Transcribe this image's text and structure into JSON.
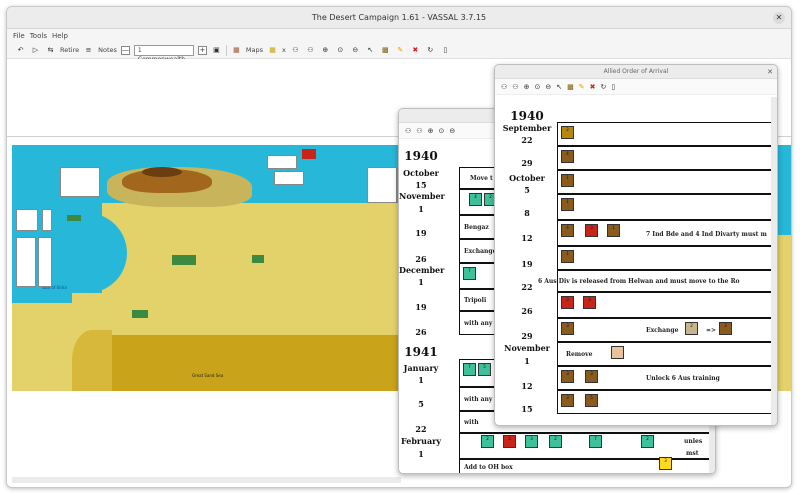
{
  "app": {
    "title": "The Desert Campaign 1.61 - VASSAL 3.7.15"
  },
  "menu": [
    "File",
    "Tools",
    "Help"
  ],
  "toolbar": {
    "retire": "Retire",
    "notes": "Notes",
    "minus": "—",
    "plus": "+",
    "faction": "1 Commonwealth",
    "maps": "Maps",
    "x": "x"
  },
  "map": {
    "label_gulf": "Gulf of Sidra",
    "label_sea": "Great Sand Sea"
  },
  "allied_window": {
    "title": "Allied Order of Arrival",
    "dates": [
      {
        "text": "1940",
        "size": 12
      },
      {
        "text": "September",
        "size": 8
      },
      {
        "text": "22",
        "size": 8
      },
      {
        "text": "29",
        "size": 8
      },
      {
        "text": "October",
        "size": 8
      },
      {
        "text": "5",
        "size": 8
      },
      {
        "text": "8",
        "size": 8
      },
      {
        "text": "12",
        "size": 8
      },
      {
        "text": "19",
        "size": 8
      },
      {
        "text": "22",
        "size": 8
      },
      {
        "text": "26",
        "size": 8
      },
      {
        "text": "29",
        "size": 8
      },
      {
        "text": "November",
        "size": 8
      },
      {
        "text": "1",
        "size": 8
      },
      {
        "text": "12",
        "size": 8
      },
      {
        "text": "15",
        "size": 8
      }
    ],
    "row_texts": {
      "ind_bde": "7 Ind Bde and 4 Ind Divarty must m",
      "aus_div": "6 Aus Div is released from Helwan and must move to the Ro",
      "exchange": "Exchange",
      "arrow": "=>",
      "remove": "Remove",
      "unlock": "Unlock 6 Aus training"
    }
  },
  "axis_window": {
    "dates": [
      {
        "text": "1940",
        "size": 12
      },
      {
        "text": "October",
        "size": 8
      },
      {
        "text": "15",
        "size": 8
      },
      {
        "text": "November",
        "size": 8
      },
      {
        "text": "1",
        "size": 8
      },
      {
        "text": "19",
        "size": 8
      },
      {
        "text": "26",
        "size": 8
      },
      {
        "text": "December",
        "size": 8
      },
      {
        "text": "1",
        "size": 8
      },
      {
        "text": "19",
        "size": 8
      },
      {
        "text": "26",
        "size": 8
      },
      {
        "text": "1941",
        "size": 12
      },
      {
        "text": "January",
        "size": 8
      },
      {
        "text": "1",
        "size": 8
      },
      {
        "text": "5",
        "size": 8
      },
      {
        "text": "22",
        "size": 8
      },
      {
        "text": "February",
        "size": 8
      },
      {
        "text": "1",
        "size": 8
      }
    ],
    "row_texts": {
      "move": "Move t",
      "bengazi": "Bengaz",
      "exchange": "Exchange",
      "tripoli": "Tripoli",
      "with_any": "with any",
      "with_any2": "with any",
      "with": "with",
      "unless": "unles",
      "must": "mst",
      "add": "Add to OH box"
    }
  },
  "colors": {
    "sea": "#27b7d8",
    "desert": "#e3d26a",
    "counter_brown": "#8b5a1d",
    "counter_red": "#c92419",
    "counter_green": "#3ec19a",
    "counter_yellow": "#ffd81f"
  }
}
